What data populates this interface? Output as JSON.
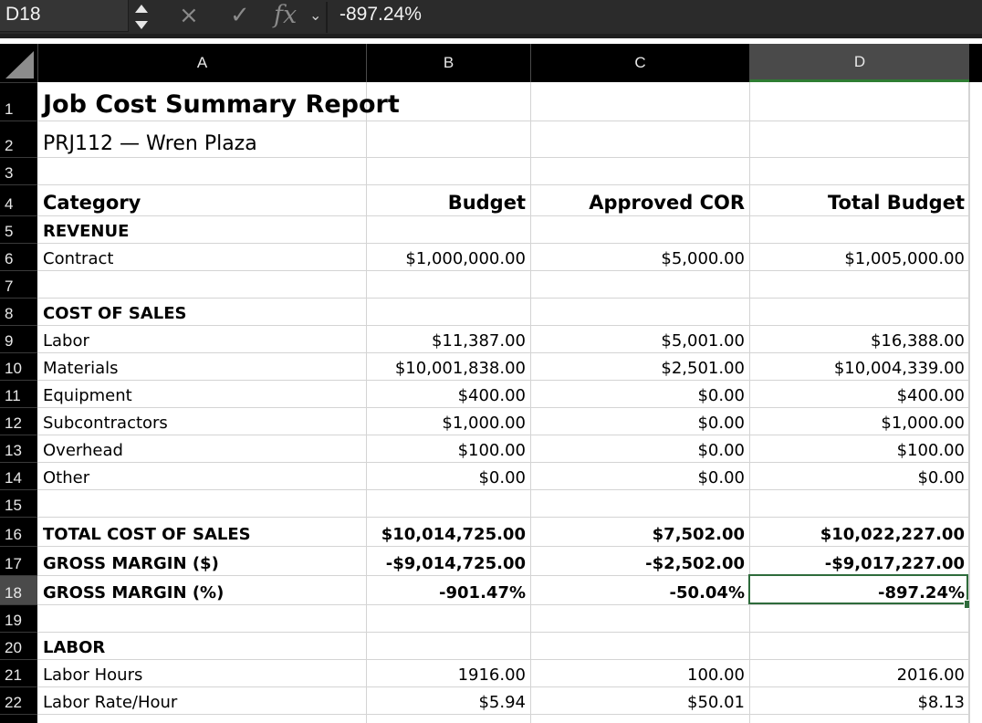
{
  "formula_bar": {
    "name_box": "D18",
    "cancel_icon": "×",
    "confirm_icon": "✓",
    "fx_label": "fx",
    "value": "-897.24%"
  },
  "columns": [
    "A",
    "B",
    "C",
    "D"
  ],
  "rows": [
    "1",
    "2",
    "3",
    "4",
    "5",
    "6",
    "7",
    "8",
    "9",
    "10",
    "11",
    "12",
    "13",
    "14",
    "15",
    "16",
    "17",
    "18",
    "19",
    "20",
    "21",
    "22"
  ],
  "selected_cell": "D18",
  "sheet": {
    "title": "Job Cost Summary Report",
    "project": "PRJ112 — Wren Plaza",
    "headers": [
      "Category",
      "Budget",
      "Approved COR",
      "Total Budget"
    ],
    "revenue_label": "REVENUE",
    "contract": [
      "Contract",
      "$1,000,000.00",
      "$5,000.00",
      "$1,005,000.00"
    ],
    "cos_label": "COST OF SALES",
    "labor": [
      "Labor",
      "$11,387.00",
      "$5,001.00",
      "$16,388.00"
    ],
    "materials": [
      "Materials",
      "$10,001,838.00",
      "$2,501.00",
      "$10,004,339.00"
    ],
    "equipment": [
      "Equipment",
      "$400.00",
      "$0.00",
      "$400.00"
    ],
    "subcontractors": [
      "Subcontractors",
      "$1,000.00",
      "$0.00",
      "$1,000.00"
    ],
    "overhead": [
      "Overhead",
      "$100.00",
      "$0.00",
      "$100.00"
    ],
    "other": [
      "Other",
      "$0.00",
      "$0.00",
      "$0.00"
    ],
    "total_cos": [
      "TOTAL COST OF SALES",
      "$10,014,725.00",
      "$7,502.00",
      "$10,022,227.00"
    ],
    "gm_dollar": [
      "GROSS MARGIN ($)",
      "-$9,014,725.00",
      "-$2,502.00",
      "-$9,017,227.00"
    ],
    "gm_pct": [
      "GROSS MARGIN (%)",
      "-901.47%",
      "-50.04%",
      "-897.24%"
    ],
    "labor_label": "LABOR",
    "labor_hours": [
      "Labor Hours",
      "1916.00",
      "100.00",
      "2016.00"
    ],
    "labor_rate": [
      "Labor Rate/Hour",
      "$5.94",
      "$50.01",
      "$8.13"
    ]
  }
}
